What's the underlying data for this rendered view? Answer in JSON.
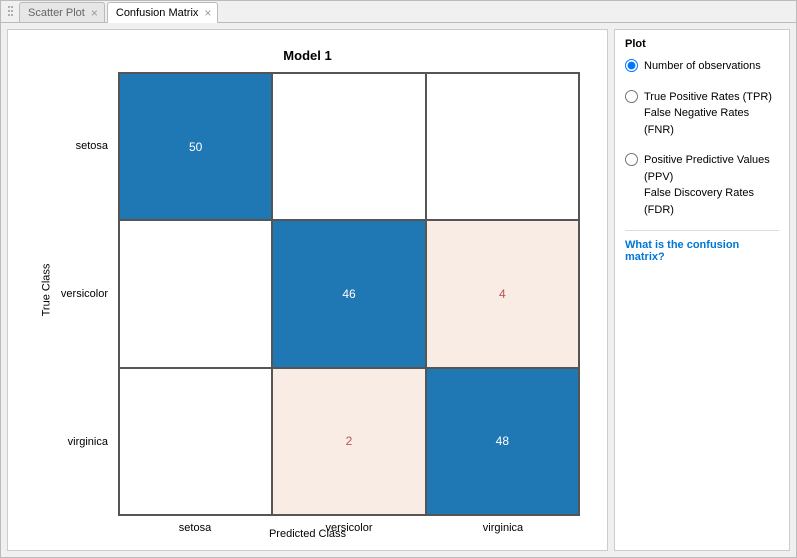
{
  "tabs": [
    {
      "label": "Scatter Plot",
      "active": false
    },
    {
      "label": "Confusion Matrix",
      "active": true
    }
  ],
  "side": {
    "heading": "Plot",
    "options": [
      {
        "label": "Number of observations",
        "checked": true
      },
      {
        "label": "True Positive Rates (TPR)\nFalse Negative Rates (FNR)",
        "checked": false
      },
      {
        "label": "Positive Predictive Values (PPV)\nFalse Discovery Rates (FDR)",
        "checked": false
      }
    ],
    "help_link": "What is the confusion matrix?"
  },
  "chart_data": {
    "type": "heatmap",
    "title": "Model 1",
    "xlabel": "Predicted Class",
    "ylabel": "True Class",
    "categories": [
      "setosa",
      "versicolor",
      "virginica"
    ],
    "matrix": [
      [
        50,
        0,
        0
      ],
      [
        0,
        46,
        4
      ],
      [
        0,
        2,
        48
      ]
    ],
    "color_scale": {
      "high": "#1f77b4",
      "low": "#f9ece4",
      "zero": "#ffffff"
    }
  }
}
